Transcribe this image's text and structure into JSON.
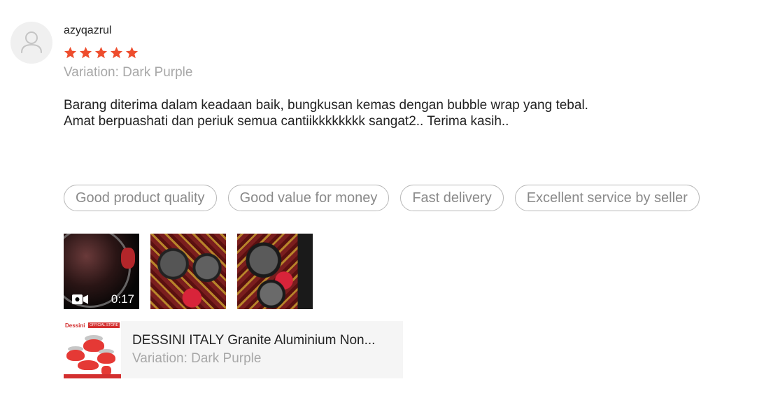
{
  "review": {
    "username": "azyqazrul",
    "rating": 5,
    "rating_max": 5,
    "star_color": "#ee4d2d",
    "variation": "Variation: Dark Purple",
    "text": "Barang diterima dalam keadaan baik, bungkusan kemas dengan bubble wrap yang tebal.\nAmat berpuashati dan periuk semua cantiikkkkkkkk sangat2.. Terima kasih..",
    "tags": [
      "Good product quality",
      "Good value for money",
      "Fast delivery",
      "Excellent service by seller"
    ],
    "media": {
      "video_duration": "0:17",
      "video_icon": "video-camera-icon"
    }
  },
  "product": {
    "brand": "Dessini",
    "store_badge": "OFFICIAL STORE",
    "name": "DESSINI ITALY Granite Aluminium Non...",
    "variation": "Variation: Dark Purple"
  }
}
